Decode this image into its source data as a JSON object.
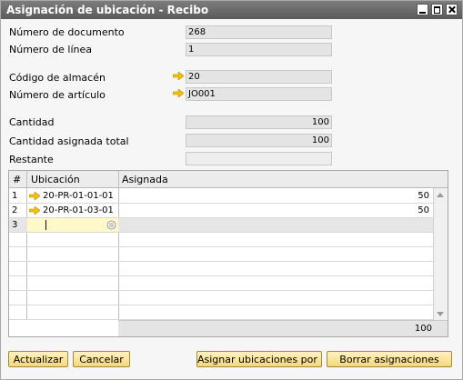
{
  "window": {
    "title": "Asignación de ubicación - Recibo"
  },
  "form": {
    "doc_number_label": "Número de documento",
    "doc_number_value": "268",
    "line_number_label": "Número de línea",
    "line_number_value": "1",
    "warehouse_label": "Código de almacén",
    "warehouse_value": "20",
    "item_label": "Número de artículo",
    "item_value": "JO001",
    "qty_label": "Cantidad",
    "qty_value": "100",
    "assigned_total_label": "Cantidad asignada total",
    "assigned_total_value": "100",
    "remaining_label": "Restante",
    "remaining_value": ""
  },
  "grid": {
    "headers": {
      "num": "#",
      "location": "Ubicación",
      "assigned": "Asignada"
    },
    "rows": [
      {
        "num": "1",
        "location": "20-PR-01-01-01",
        "assigned": "50"
      },
      {
        "num": "2",
        "location": "20-PR-01-03-01",
        "assigned": "50"
      },
      {
        "num": "3",
        "location": "",
        "assigned": ""
      }
    ],
    "total": "100"
  },
  "buttons": {
    "update": "Actualizar",
    "cancel": "Cancelar",
    "assign_default": "Asignar ubicaciones por defec",
    "clear": "Borrar asignaciones"
  },
  "colors": {
    "titlebar": "#6a6a6a",
    "button": "#f6d77a",
    "arrow": "#f2c200",
    "active_cell": "#fff8c8"
  }
}
